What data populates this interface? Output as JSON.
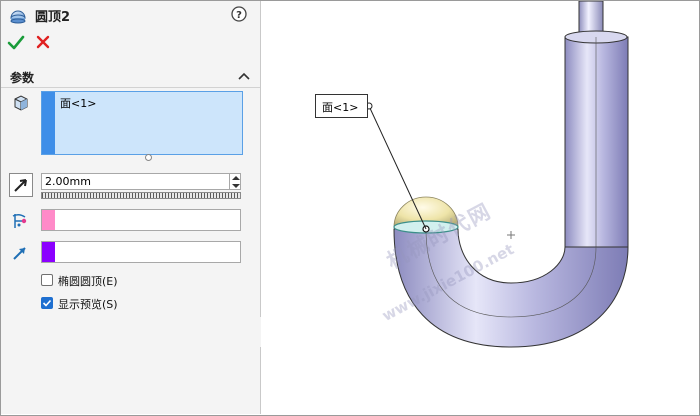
{
  "feature": {
    "title": "圆顶2"
  },
  "parameters": {
    "group_title": "参数",
    "faces_selected": [
      "面<1>"
    ],
    "distance_value": "2.00mm",
    "constraint_color": "#ff8ac8",
    "direction_color": "#8b00ff",
    "elliptical_dome": {
      "label": "椭圆圆顶(E)",
      "checked": false
    },
    "show_preview": {
      "label": "显示预览(S)",
      "checked": true
    }
  },
  "graphics": {
    "callout_label": "面<1>",
    "watermark_line1": "机械时代网",
    "watermark_line2": "www.jixie100.net"
  },
  "colors": {
    "accent": "#3e8ee8",
    "selection_bg": "#cde5fb",
    "ok": "#1a9c3a",
    "cancel": "#e02020"
  }
}
